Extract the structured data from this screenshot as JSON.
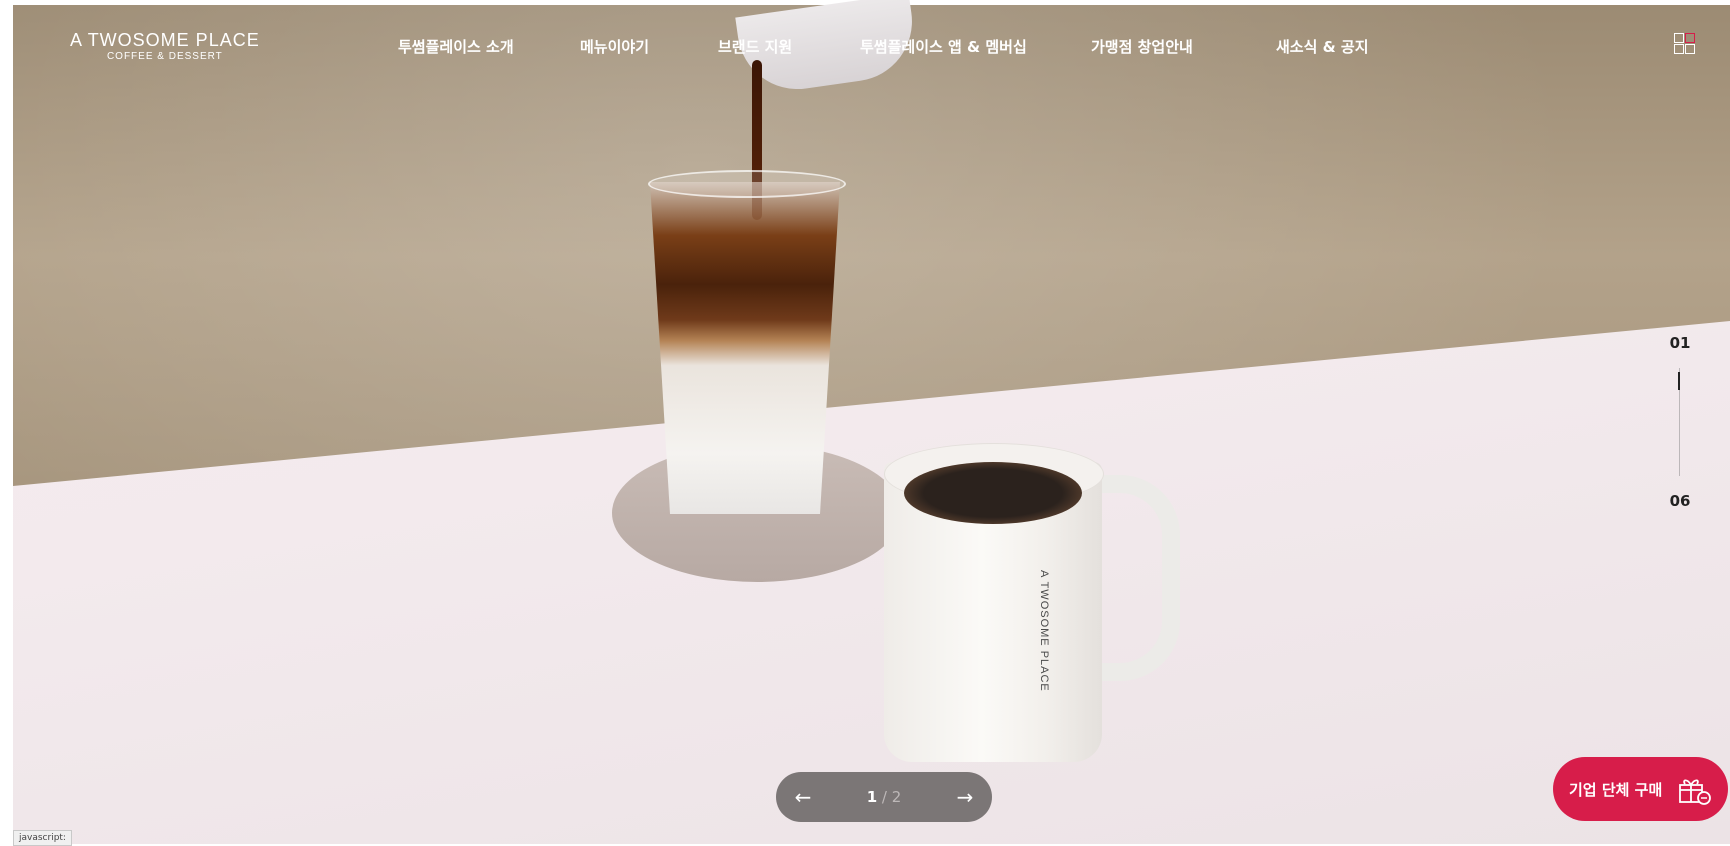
{
  "brand": {
    "name_line1": "A TWOSOME PLACE",
    "name_line2": "COFFEE & DESSERT"
  },
  "nav": {
    "items": [
      {
        "label": "투썸플레이스 소개"
      },
      {
        "label": "메뉴이야기"
      },
      {
        "label": "브랜드 지원"
      },
      {
        "label": "투썸플레이스 앱 & 멤버십"
      },
      {
        "label": "가맹점 창업안내"
      },
      {
        "label": "새소식 & 공지"
      }
    ],
    "menu_icon": "grid-menu-icon"
  },
  "hero": {
    "mug_print": "A TWOSOME PLACE"
  },
  "slide_indicator": {
    "current": "01",
    "total": "06",
    "progress_fraction": 0.1667
  },
  "pager": {
    "current": "1",
    "separator": "/",
    "total": "2",
    "prev_icon": "arrow-left-icon",
    "next_icon": "arrow-right-icon"
  },
  "corporate_button": {
    "label": "기업 단체 구매",
    "icon": "gift-icon"
  },
  "status_bar": {
    "text": "javascript:"
  },
  "colors": {
    "accent": "#d71d4a",
    "pager_bg": "#7b7676",
    "wall": "#b3a28a",
    "table": "#f3eaed"
  }
}
